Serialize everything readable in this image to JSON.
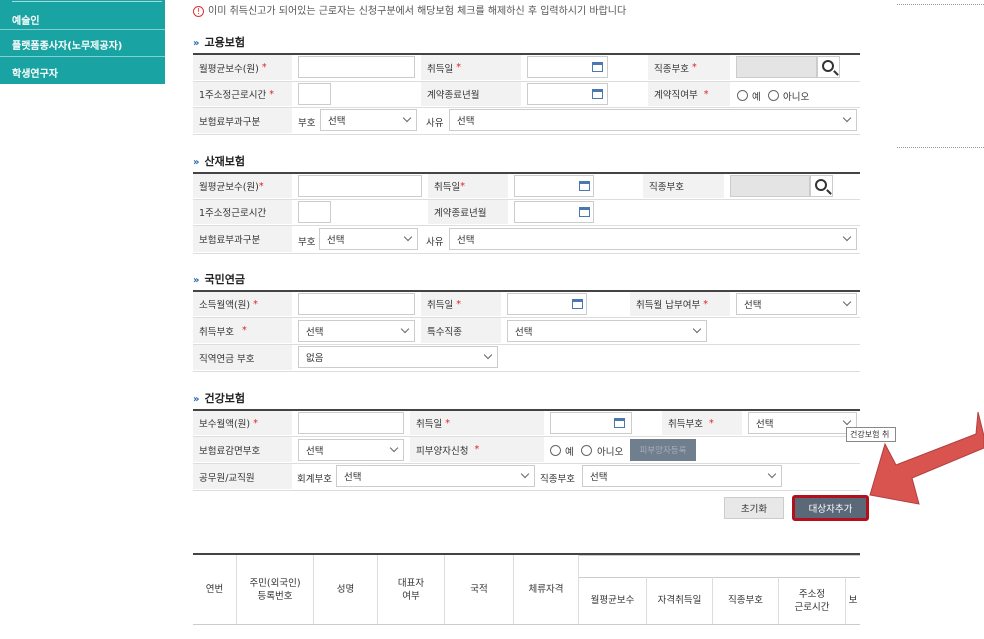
{
  "sidebar": {
    "items": [
      {
        "label": "예술인"
      },
      {
        "label": "플랫폼종사자(노무제공자)"
      },
      {
        "label": "학생연구자"
      }
    ]
  },
  "notice": {
    "text": "이미 취득신고가 되어있는 근로자는 신청구분에서 해당보험 체크를 해제하신 후 입력하시기 바랍니다"
  },
  "required_mark": "*",
  "employment": {
    "title": "고용보험",
    "labels": {
      "monthly_wage": "월평균보수(원)",
      "acq_date": "취득일",
      "job_code": "직종부호",
      "weekly_hours": "1주소정근로시간",
      "contract_end": "계약종료년월",
      "contract_worker": "계약직여부",
      "premium_class": "보험료부과구분",
      "code": "부호",
      "reason": "사유"
    },
    "selects": {
      "code": "선택",
      "reason": "선택"
    },
    "radio": {
      "yes": "예",
      "no": "아니오"
    }
  },
  "industrial": {
    "title": "산재보험",
    "labels": {
      "monthly_wage": "월평균보수(원)",
      "acq_date": "취득일",
      "job_code": "직종부호",
      "weekly_hours": "1주소정근로시간",
      "contract_end": "계약종료년월",
      "premium_class": "보험료부과구분",
      "code": "부호",
      "reason": "사유"
    },
    "selects": {
      "code": "선택",
      "reason": "선택"
    }
  },
  "pension": {
    "title": "국민연금",
    "labels": {
      "monthly_income": "소득월액(원)",
      "acq_date": "취득일",
      "payment_month": "취득월 납부여부",
      "acq_code": "취득부호",
      "special_job": "특수직종",
      "occupational_code": "직역연금 부호"
    },
    "selects": {
      "payment_month": "선택",
      "acq_code": "선택",
      "special_job": "선택",
      "occupational_code": "없음"
    }
  },
  "health": {
    "title": "건강보험",
    "labels": {
      "monthly_wage": "보수월액(원)",
      "acq_date": "취득일",
      "acq_code": "취득부호",
      "reduction": "보험료감면부호",
      "dependent": "피부양자신청",
      "public_official": "공무원/교직원",
      "account_code": "회계부호",
      "job_code": "직종부호"
    },
    "selects": {
      "acq_code": "선택",
      "reduction": "선택",
      "account_code": "선택",
      "job_code": "선택"
    },
    "radio": {
      "yes": "예",
      "no": "아니오"
    },
    "dependent_button": "피부양자등록",
    "tooltip": "건강보험 취"
  },
  "actions": {
    "reset": "초기화",
    "add_target": "대상자추가"
  },
  "table": {
    "headers": [
      "연번",
      "주민(외국인)\n등록번호",
      "성명",
      "대표자\n여부",
      "국적",
      "체류자격",
      "월평균보수",
      "자격취득일",
      "직종부호",
      "주소정\n근로시간",
      "보"
    ]
  },
  "colors": {
    "sidebar": "#1aa3a3",
    "accent_arrow": "#d9534f",
    "highlight_border": "#b3101d",
    "primary_button": "#5a6878"
  }
}
